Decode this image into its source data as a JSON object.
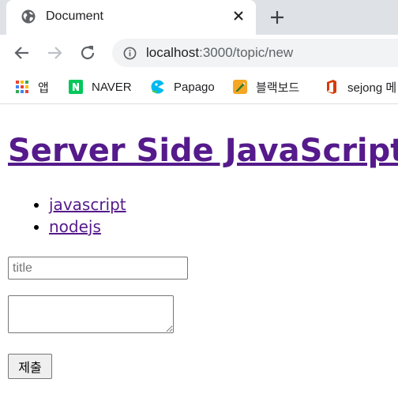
{
  "browser": {
    "tab": {
      "title": "Document",
      "favicon": "globe-icon",
      "close_icon": "close-icon"
    },
    "new_tab_icon": "plus-icon",
    "nav": {
      "back_icon": "back-arrow-icon",
      "forward_icon": "forward-arrow-icon",
      "reload_icon": "reload-icon"
    },
    "address": {
      "info_icon": "info-icon",
      "host": "localhost",
      "path": ":3000/topic/new"
    }
  },
  "bookmarks": [
    {
      "label": "앱",
      "icon": "apps-grid-icon",
      "color": "#ea4335"
    },
    {
      "label": "NAVER",
      "icon": "naver-icon",
      "color": "#03c75a"
    },
    {
      "label": "Papago",
      "icon": "papago-icon",
      "color": "#00b9f1"
    },
    {
      "label": "블랙보드",
      "icon": "blackboard-icon",
      "color": "#f5a623"
    },
    {
      "label": "sejong 메",
      "icon": "office-icon",
      "color": "#d83b01"
    }
  ],
  "page": {
    "heading": "Server Side JavaScript",
    "topics": [
      "javascript",
      "nodejs"
    ],
    "form": {
      "title_placeholder": "title",
      "title_value": "",
      "description_value": "",
      "submit_label": "제출"
    },
    "link_color": "#551a8b"
  }
}
